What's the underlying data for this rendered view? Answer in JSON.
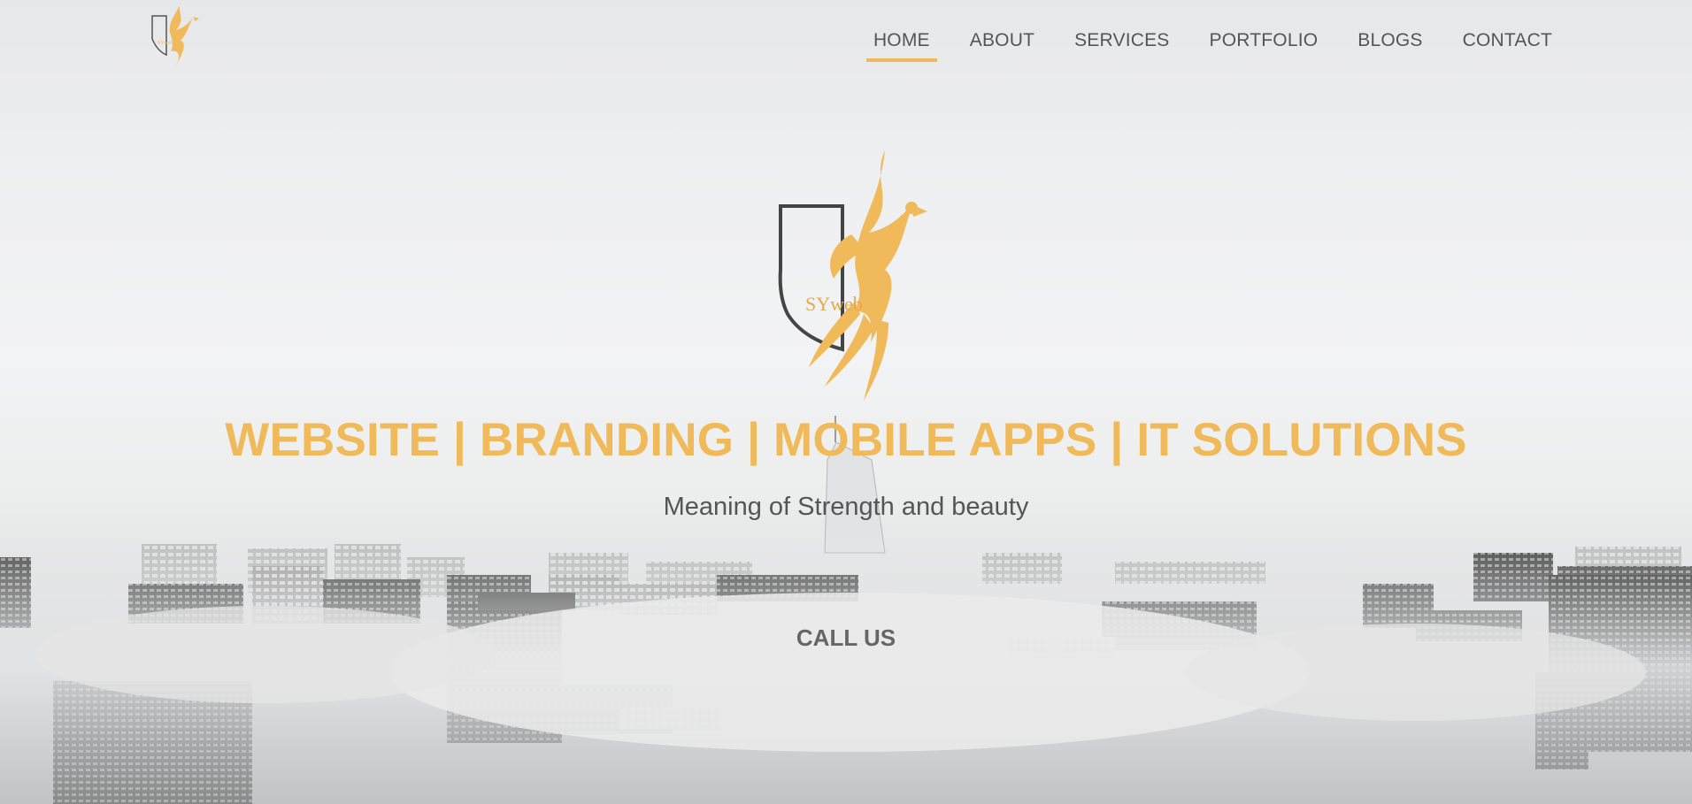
{
  "brand": {
    "logo_text": "SYweb"
  },
  "nav": {
    "items": [
      {
        "label": "HOME",
        "active": true
      },
      {
        "label": "ABOUT",
        "active": false
      },
      {
        "label": "SERVICES",
        "active": false
      },
      {
        "label": "PORTFOLIO",
        "active": false
      },
      {
        "label": "BLOGS",
        "active": false
      },
      {
        "label": "CONTACT",
        "active": false
      }
    ]
  },
  "hero": {
    "tagline": "WEBSITE | BRANDING | MOBILE APPS | IT SOLUTIONS",
    "subtitle": "Meaning of Strength and beauty",
    "cta_label": "CALL US"
  },
  "colors": {
    "accent": "#f0b95a",
    "nav_text": "#555555",
    "shield_outline": "#444444"
  },
  "icons": {
    "logo": "phoenix-shield-logo",
    "background": "city-skyline-in-fog"
  }
}
